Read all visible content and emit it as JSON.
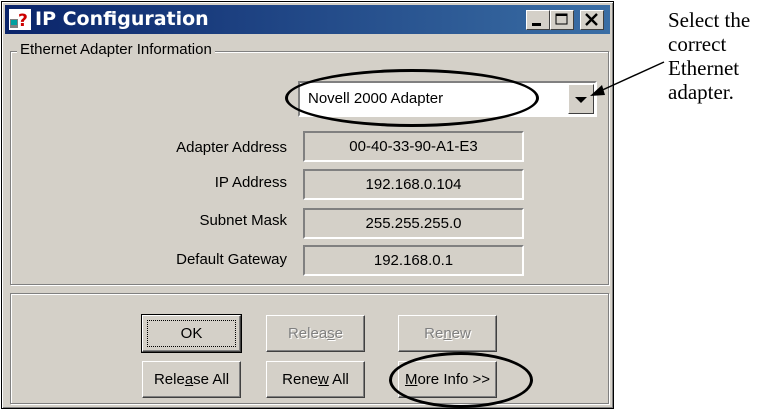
{
  "window": {
    "title": "IP Configuration"
  },
  "adapter_group": {
    "legend": "Ethernet  Adapter Information",
    "adapter_select": {
      "selected": "Novell 2000 Adapter"
    },
    "fields": [
      {
        "label": "Adapter Address",
        "value": "00-40-33-90-A1-E3"
      },
      {
        "label": "IP Address",
        "value": "192.168.0.104"
      },
      {
        "label": "Subnet Mask",
        "value": "255.255.255.0"
      },
      {
        "label": "Default Gateway",
        "value": "192.168.0.1"
      }
    ]
  },
  "buttons": {
    "ok": "OK",
    "release_pre": "Relea",
    "release_key": "s",
    "release_post": "e",
    "renew_pre": "Re",
    "renew_key": "n",
    "renew_post": "ew",
    "release_all_pre": "Rele",
    "release_all_key": "a",
    "release_all_post": "se All",
    "renew_all_pre": "Rene",
    "renew_all_key": "w",
    "renew_all_post": " All",
    "more_info_pre": "",
    "more_info_key": "M",
    "more_info_post": "ore Info >>"
  },
  "annotation": {
    "lines": [
      "Select the",
      "correct",
      "Ethernet",
      "adapter."
    ]
  },
  "colors": {
    "face": "#d4d0c8",
    "titlebar_start": "#0a246a",
    "titlebar_end": "#3a6ea5",
    "disabled_text": "#808080"
  }
}
